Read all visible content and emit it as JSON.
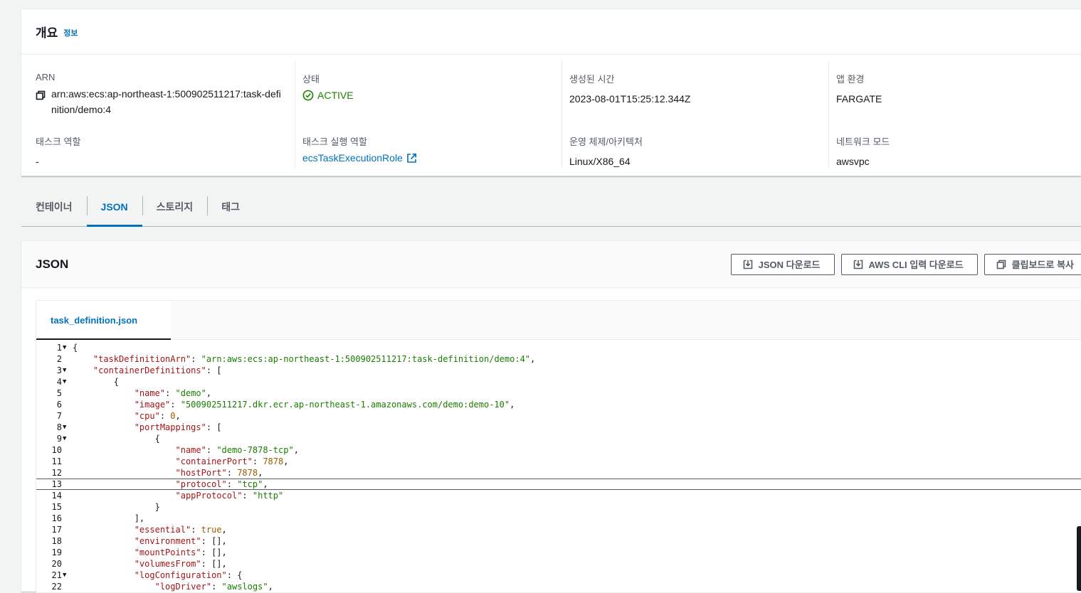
{
  "overview": {
    "title": "개요",
    "info": "정보",
    "arn_label": "ARN",
    "arn_value": "arn:aws:ecs:ap-northeast-1:500902511217:task-definition/demo:4",
    "status_label": "상태",
    "status_value": "ACTIVE",
    "created_label": "생성된 시간",
    "created_value": "2023-08-01T15:25:12.344Z",
    "env_label": "앱 환경",
    "env_value": "FARGATE",
    "task_role_label": "태스크 역할",
    "task_role_value": "-",
    "exec_role_label": "태스크 실행 역할",
    "exec_role_value": "ecsTaskExecutionRole",
    "os_label": "운영 체제/아키텍처",
    "os_value": "Linux/X86_64",
    "network_label": "네트워크 모드",
    "network_value": "awsvpc"
  },
  "tabs": [
    {
      "label": "컨테이너"
    },
    {
      "label": "JSON"
    },
    {
      "label": "스토리지"
    },
    {
      "label": "태그"
    }
  ],
  "active_tab": "JSON",
  "json_panel": {
    "title": "JSON",
    "download_json": "JSON 다운로드",
    "download_cli": "AWS CLI 입력 다운로드",
    "copy_clipboard": "클립보드로 복사",
    "file_tab": "task_definition.json"
  },
  "code_lines": [
    {
      "n": "1",
      "fold": true,
      "indent": 0,
      "parts": [
        [
          "p",
          "{"
        ]
      ]
    },
    {
      "n": "2",
      "fold": false,
      "indent": 1,
      "parts": [
        [
          "k",
          "\"taskDefinitionArn\""
        ],
        [
          "p",
          ": "
        ],
        [
          "s",
          "\"arn:aws:ecs:ap-northeast-1:500902511217:task-definition/demo:4\""
        ],
        [
          "p",
          ","
        ]
      ]
    },
    {
      "n": "3",
      "fold": true,
      "indent": 1,
      "parts": [
        [
          "k",
          "\"containerDefinitions\""
        ],
        [
          "p",
          ": ["
        ]
      ]
    },
    {
      "n": "4",
      "fold": true,
      "indent": 2,
      "parts": [
        [
          "p",
          "{"
        ]
      ]
    },
    {
      "n": "5",
      "fold": false,
      "indent": 3,
      "parts": [
        [
          "k",
          "\"name\""
        ],
        [
          "p",
          ": "
        ],
        [
          "s",
          "\"demo\""
        ],
        [
          "p",
          ","
        ]
      ]
    },
    {
      "n": "6",
      "fold": false,
      "indent": 3,
      "parts": [
        [
          "k",
          "\"image\""
        ],
        [
          "p",
          ": "
        ],
        [
          "s",
          "\"500902511217.dkr.ecr.ap-northeast-1.amazonaws.com/demo:demo-10\""
        ],
        [
          "p",
          ","
        ]
      ]
    },
    {
      "n": "7",
      "fold": false,
      "indent": 3,
      "parts": [
        [
          "k",
          "\"cpu\""
        ],
        [
          "p",
          ": "
        ],
        [
          "n",
          "0"
        ],
        [
          "p",
          ","
        ]
      ]
    },
    {
      "n": "8",
      "fold": true,
      "indent": 3,
      "parts": [
        [
          "k",
          "\"portMappings\""
        ],
        [
          "p",
          ": ["
        ]
      ]
    },
    {
      "n": "9",
      "fold": true,
      "indent": 4,
      "parts": [
        [
          "p",
          "{"
        ]
      ]
    },
    {
      "n": "10",
      "fold": false,
      "indent": 5,
      "parts": [
        [
          "k",
          "\"name\""
        ],
        [
          "p",
          ": "
        ],
        [
          "s",
          "\"demo-7878-tcp\""
        ],
        [
          "p",
          ","
        ]
      ]
    },
    {
      "n": "11",
      "fold": false,
      "indent": 5,
      "parts": [
        [
          "k",
          "\"containerPort\""
        ],
        [
          "p",
          ": "
        ],
        [
          "n",
          "7878"
        ],
        [
          "p",
          ","
        ]
      ]
    },
    {
      "n": "12",
      "fold": false,
      "indent": 5,
      "parts": [
        [
          "k",
          "\"hostPort\""
        ],
        [
          "p",
          ": "
        ],
        [
          "n",
          "7878"
        ],
        [
          "p",
          ","
        ]
      ]
    },
    {
      "n": "13",
      "fold": false,
      "indent": 5,
      "hl": true,
      "parts": [
        [
          "k",
          "\"protocol\""
        ],
        [
          "p",
          ": "
        ],
        [
          "s",
          "\"tcp\""
        ],
        [
          "p",
          ","
        ]
      ]
    },
    {
      "n": "14",
      "fold": false,
      "indent": 5,
      "parts": [
        [
          "k",
          "\"appProtocol\""
        ],
        [
          "p",
          ": "
        ],
        [
          "s",
          "\"http\""
        ]
      ]
    },
    {
      "n": "15",
      "fold": false,
      "indent": 4,
      "parts": [
        [
          "p",
          "}"
        ]
      ]
    },
    {
      "n": "16",
      "fold": false,
      "indent": 3,
      "parts": [
        [
          "p",
          "],"
        ]
      ]
    },
    {
      "n": "17",
      "fold": false,
      "indent": 3,
      "parts": [
        [
          "k",
          "\"essential\""
        ],
        [
          "p",
          ": "
        ],
        [
          "n",
          "true"
        ],
        [
          "p",
          ","
        ]
      ]
    },
    {
      "n": "18",
      "fold": false,
      "indent": 3,
      "parts": [
        [
          "k",
          "\"environment\""
        ],
        [
          "p",
          ": [],"
        ]
      ]
    },
    {
      "n": "19",
      "fold": false,
      "indent": 3,
      "parts": [
        [
          "k",
          "\"mountPoints\""
        ],
        [
          "p",
          ": [],"
        ]
      ]
    },
    {
      "n": "20",
      "fold": false,
      "indent": 3,
      "parts": [
        [
          "k",
          "\"volumesFrom\""
        ],
        [
          "p",
          ": [],"
        ]
      ]
    },
    {
      "n": "21",
      "fold": true,
      "indent": 3,
      "parts": [
        [
          "k",
          "\"logConfiguration\""
        ],
        [
          "p",
          ": {"
        ]
      ]
    },
    {
      "n": "22",
      "fold": false,
      "indent": 4,
      "parts": [
        [
          "k",
          "\"logDriver\""
        ],
        [
          "p",
          ": "
        ],
        [
          "s",
          "\"awslogs\""
        ],
        [
          "p",
          ","
        ]
      ]
    }
  ]
}
